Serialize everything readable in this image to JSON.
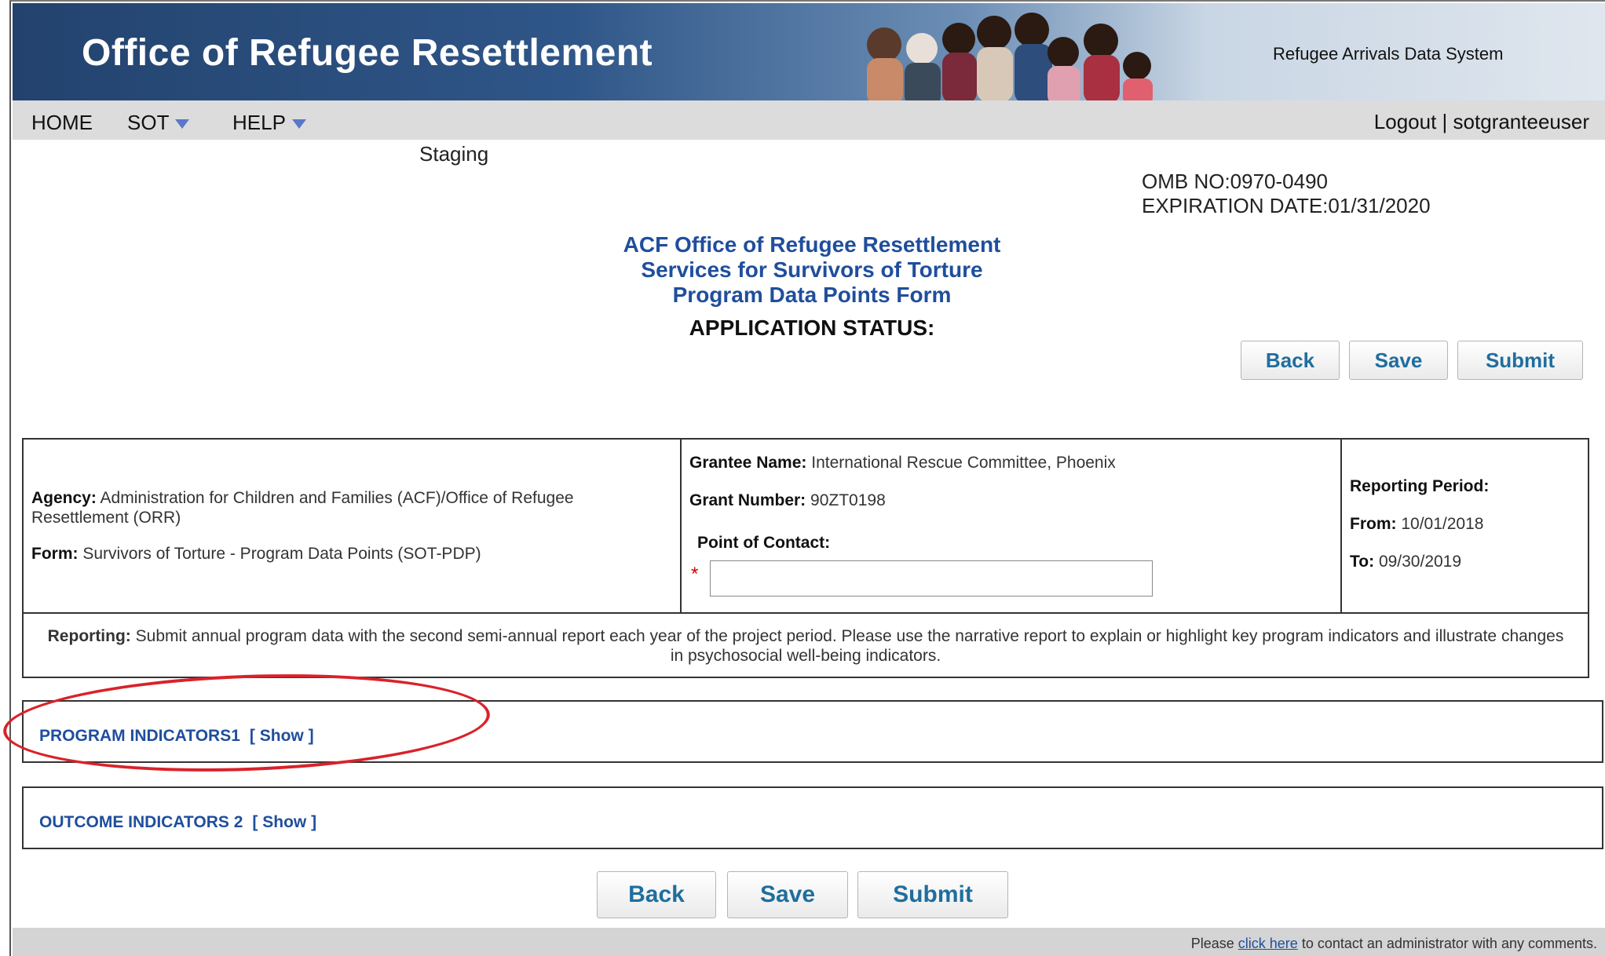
{
  "header": {
    "title": "Office of Refugee Resettlement",
    "subtitle": "Refugee Arrivals Data System"
  },
  "nav": {
    "home": "HOME",
    "sot": "SOT",
    "help": "HELP",
    "logout": "Logout",
    "separator": "|",
    "user": "sotgranteeuser"
  },
  "env": "Staging",
  "omb": {
    "number": "OMB NO:0970-0490",
    "expiration": "EXPIRATION DATE:01/31/2020"
  },
  "form": {
    "line1": "ACF Office of Refugee Resettlement",
    "line2": "Services for Survivors of Torture",
    "line3": "Program Data Points Form",
    "status": "APPLICATION STATUS:"
  },
  "buttons": {
    "back": "Back",
    "save": "Save",
    "submit": "Submit"
  },
  "info": {
    "agency_label": "Agency:",
    "agency_value": "Administration for Children and Families (ACF)/Office of Refugee Resettlement (ORR)",
    "form_label": "Form:",
    "form_value": "Survivors of Torture - Program Data Points (SOT-PDP)",
    "grantee_label": "Grantee Name:",
    "grantee_value": "International Rescue Committee, Phoenix",
    "grant_label": "Grant Number:",
    "grant_value": "90ZT0198",
    "poc_label": "Point of Contact:",
    "poc_value": "",
    "required_mark": "*",
    "period_label": "Reporting Period:",
    "from_label": "From:",
    "from_value": "10/01/2018",
    "to_label": "To:",
    "to_value": "09/30/2019",
    "reporting_label": "Reporting:",
    "reporting_value": "Submit annual program data with the second semi-annual report each year of the project period. Please use the narrative report to explain or highlight key program indicators and illustrate changes in psychosocial well-being indicators."
  },
  "sections": [
    {
      "label": "PROGRAM INDICATORS1",
      "toggle": "[ Show ]"
    },
    {
      "label": "OUTCOME INDICATORS 2",
      "toggle": "[ Show ]"
    }
  ],
  "footer": {
    "prefix": "Please",
    "link": "click here",
    "suffix": "to contact an administrator with any comments."
  },
  "colors": {
    "header_blue": "#2f5688",
    "link_blue": "#1f4e9c",
    "highlight_red": "#d9222a"
  }
}
